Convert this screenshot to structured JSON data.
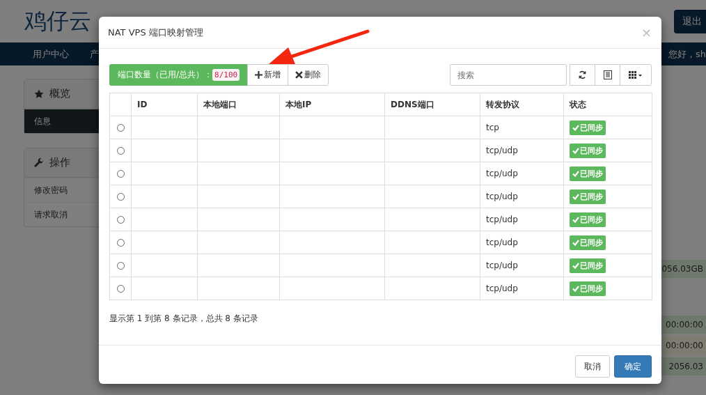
{
  "site": {
    "logo": "鸡仔云",
    "logout_button": "退出",
    "nav": [
      {
        "label": "用户中心"
      },
      {
        "label": "产"
      }
    ],
    "greeting": "您好，sh"
  },
  "sidebar": [
    {
      "title": "概览",
      "items": [
        {
          "label": "信息",
          "selected": true
        }
      ]
    },
    {
      "title": "操作",
      "items": [
        {
          "label": "修改密码",
          "selected": false
        },
        {
          "label": "请求取消",
          "selected": false
        }
      ]
    }
  ],
  "side_values": [
    {
      "text": "056.03GB",
      "kind": "success"
    },
    {
      "text": "00:00:00",
      "kind": "success"
    },
    {
      "text": "00:00:00",
      "kind": "warning"
    },
    {
      "text": "2056.03",
      "kind": "success"
    }
  ],
  "modal": {
    "title": "NAT VPS 端口映射管理",
    "close": "×",
    "port_count": {
      "label": "端口数量（已用/总共）：",
      "value": "8/100"
    },
    "toolbar_buttons": [
      {
        "kind": "add",
        "label": "新增"
      },
      {
        "kind": "delete",
        "label": "删除"
      }
    ],
    "search": {
      "placeholder": "搜索"
    },
    "table": {
      "columns": [
        "ID",
        "本地端口",
        "本地IP",
        "DDNS端口",
        "转发协议",
        "状态"
      ],
      "rows": [
        {
          "selected": false,
          "protocol": "tcp",
          "status": "已同步"
        },
        {
          "selected": false,
          "protocol": "tcp/udp",
          "status": "已同步"
        },
        {
          "selected": false,
          "protocol": "tcp/udp",
          "status": "已同步"
        },
        {
          "selected": false,
          "protocol": "tcp/udp",
          "status": "已同步"
        },
        {
          "selected": false,
          "protocol": "tcp/udp",
          "status": "已同步"
        },
        {
          "selected": false,
          "protocol": "tcp/udp",
          "status": "已同步"
        },
        {
          "selected": false,
          "protocol": "tcp/udp",
          "status": "已同步"
        },
        {
          "selected": false,
          "protocol": "tcp/udp",
          "status": "已同步"
        }
      ]
    },
    "records_info": "显示第 1 到第 8 条记录，总共 8 条记录",
    "buttons": [
      {
        "kind": "default",
        "label": "取消"
      },
      {
        "kind": "primary",
        "label": "确定"
      }
    ]
  }
}
